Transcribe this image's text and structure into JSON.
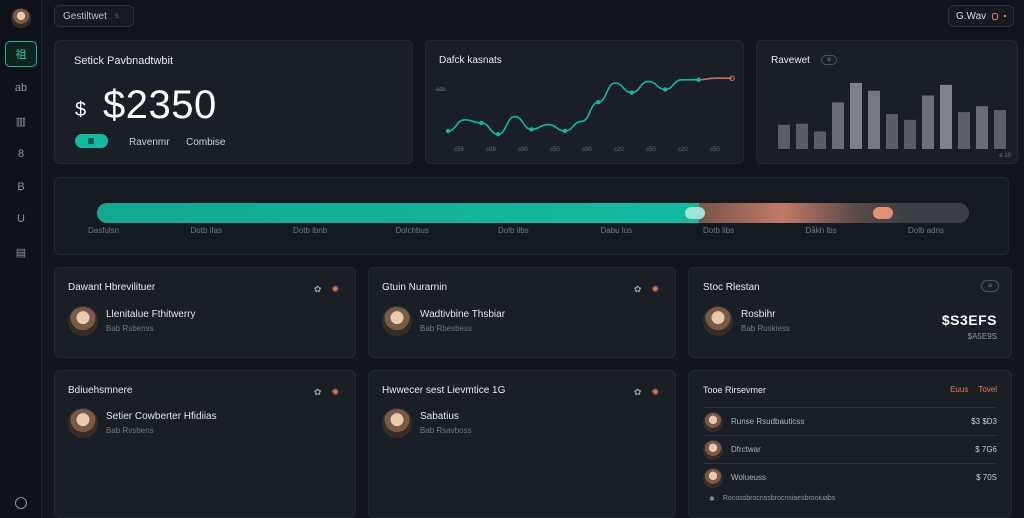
{
  "topbar": {
    "search_label": "Gestiltwet",
    "search_hint": "s",
    "user_label": "G.Wav"
  },
  "sidebar": {
    "items": [
      {
        "label": "祖",
        "active": true
      },
      {
        "label": "ab",
        "active": false
      },
      {
        "label": "▥",
        "active": false
      },
      {
        "label": "8",
        "active": false
      },
      {
        "label": "B",
        "active": false
      },
      {
        "label": "U",
        "active": false
      },
      {
        "label": "▤",
        "active": false
      }
    ]
  },
  "balance": {
    "title": "Setick Pavbnadtwbit",
    "amount": "$2350",
    "symbol": "$",
    "link_left": "Ravenmr",
    "link_right": "Combise"
  },
  "line_card": {
    "title": "Dafck kasnats",
    "y_tick": "ads",
    "x_ticks": [
      "c59",
      "c09",
      "c00",
      "c50",
      "c00",
      "c20",
      "c50",
      "c20",
      "c50"
    ]
  },
  "bar_card": {
    "title": "Ravewet",
    "pill": "u",
    "footer": "e 10"
  },
  "chart_data": [
    {
      "type": "line",
      "title": "Dafck kasnats",
      "x": [
        1,
        2,
        3,
        4,
        5,
        6,
        7,
        8,
        9,
        10,
        11,
        12,
        13,
        14,
        15,
        16,
        17,
        18
      ],
      "series": [
        {
          "values": [
            10,
            24,
            20,
            6,
            28,
            12,
            18,
            10,
            22,
            46,
            70,
            58,
            72,
            62,
            74,
            74,
            76,
            76
          ]
        }
      ],
      "colors": {
        "line": "#14b8a0",
        "line_tail": "#d06a66"
      }
    },
    {
      "type": "bar",
      "title": "Ravewet",
      "values": [
        25,
        26,
        18,
        48,
        68,
        60,
        36,
        30,
        55,
        66,
        38,
        44,
        40
      ],
      "colors": [
        "#5a5e64",
        "#5a5e64",
        "#5a5e64",
        "#6a6e74",
        "#7e8288",
        "#75797f",
        "#5a5e64",
        "#5a5e64",
        "#6e7278",
        "#80848a",
        "#5c6066",
        "#6a6e74",
        "#5c6066"
      ]
    }
  ],
  "progress": {
    "fraction": 0.69,
    "labels": [
      "Dasfulsn",
      "Dotb ifas",
      "Dotb ibnb",
      "Dolchbus",
      "Dolb ilbs",
      "Dabu lus",
      "Dotb libs",
      "Dåkh lbs",
      "Dolb adns"
    ]
  },
  "cards": {
    "c1": {
      "title": "Dawant Hbrevilituer",
      "name": "Llenitalue Fthitwerry",
      "sub": "Bab Rsbenss"
    },
    "c2": {
      "title": "Gtuin Nurarnin",
      "name": "Wadtivbine Thsbiar",
      "sub": "Bab Rbesbess"
    },
    "c3": {
      "title": "Stoc Rlestan",
      "name": "Rosbihr",
      "sub": "Bab Ruskiess",
      "value": "$S3EFS",
      "value_sub": "$A5E9S",
      "pill": "u"
    },
    "c4": {
      "title": "Bdiuehsmnere",
      "name": "Setier Cowberter Hfidiias",
      "sub": "Bab Rvsbens"
    },
    "c5": {
      "title": "Hwwecer sest Lievmtice 1G",
      "name": "Sabatius",
      "sub": "Bab Rsavboss"
    },
    "c6": {
      "title": "Tooe Rirsevmer",
      "links": [
        "Euus",
        "Tovel"
      ],
      "rows": [
        {
          "name": "Runse Rsudbauticss",
          "amount": "$3 $D3"
        },
        {
          "name": "Dfrctwar",
          "amount": "$ 7G6"
        },
        {
          "name": "Wolueuss",
          "amount": "$ 70S"
        }
      ],
      "footer": "Rocossbrocnssbrocnsiaesbrooiuabs"
    }
  }
}
